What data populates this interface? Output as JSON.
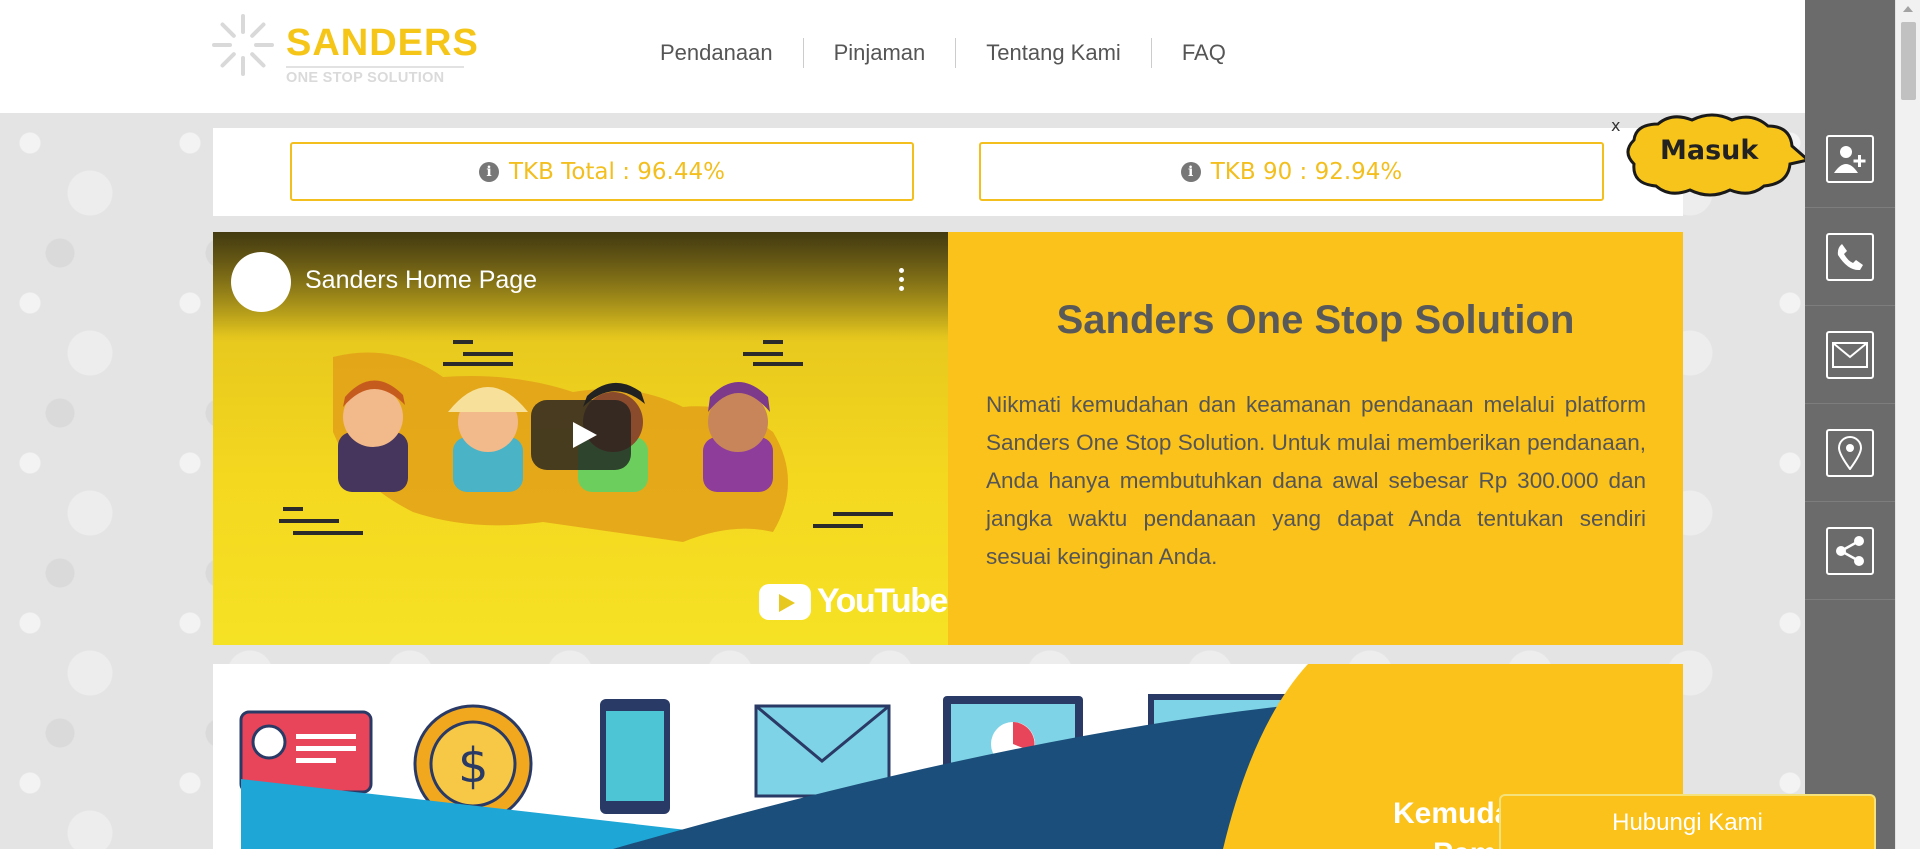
{
  "brand": {
    "name": "SANDERS",
    "tagline": "ONE STOP SOLUTION",
    "color": "#f5c518"
  },
  "nav": {
    "items": [
      {
        "label": "Pendanaan"
      },
      {
        "label": "Pinjaman"
      },
      {
        "label": "Tentang Kami"
      },
      {
        "label": "FAQ"
      }
    ]
  },
  "tkb": {
    "total": "TKB Total : 96.44%",
    "tkb90": "TKB 90 : 92.94%",
    "info_glyph": "i",
    "accent": "#f2bf1f"
  },
  "popup": {
    "close_label": "x",
    "login_label": "Masuk"
  },
  "video": {
    "title": "Sanders Home Page",
    "provider": "YouTube"
  },
  "hero": {
    "title": "Sanders One Stop Solution",
    "description": "Nikmati kemudahan dan keamanan pendanaan melalui platform Sanders One Stop Solution. Untuk mulai memberikan pendanaan, Anda hanya membutuhkan dana awal sebesar Rp 300.000 dan jangka waktu pendanaan yang dapat Anda tentukan sendiri sesuai keinginan Anda.",
    "background": "#fbc21b"
  },
  "feature": {
    "headline_line1": "Kemuda",
    "headline_line2": "Pem"
  },
  "sidebar": {
    "items": [
      {
        "icon": "add-user-icon"
      },
      {
        "icon": "phone-icon"
      },
      {
        "icon": "mail-icon"
      },
      {
        "icon": "location-pin-icon"
      },
      {
        "icon": "share-icon"
      }
    ]
  },
  "contact": {
    "label": "Hubungi Kami"
  }
}
